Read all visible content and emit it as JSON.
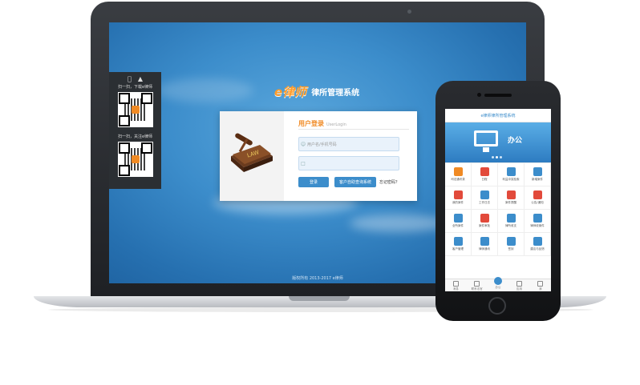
{
  "colors": {
    "accent": "#3c8dcb",
    "orange": "#f08a24",
    "screen_bg": "#3c8dcb"
  },
  "qr_panel": {
    "os_icons": [
      "apple-icon",
      "android-icon"
    ],
    "download_caption": "扫一扫，下载e律师",
    "follow_caption": "扫一扫，关注e律师"
  },
  "brand": {
    "logo": "e律师",
    "title": "律所管理系统"
  },
  "login": {
    "title": "用户登录",
    "subtitle": "UserLogin",
    "username_placeholder": "用户名/手机号码",
    "password_placeholder": "",
    "login_button": "登录",
    "client_button": "客户自助查询系统",
    "forgot_link": "忘记密码？"
  },
  "footer": {
    "copyright": "版权所有 2013-2017 e律师"
  },
  "phone": {
    "header_title": "e律师律所管理系统",
    "banner_text": "办公",
    "grid": [
      {
        "label": "司法通讯录",
        "color": "#f08a24"
      },
      {
        "label": "日程",
        "color": "#e24a3b"
      },
      {
        "label": "利益冲突检索",
        "color": "#3c8dcb"
      },
      {
        "label": "新增案件",
        "color": "#3c8dcb"
      },
      {
        "label": "我的案件",
        "color": "#e24a3b"
      },
      {
        "label": "工作日志",
        "color": "#3c8dcb"
      },
      {
        "label": "案件提醒",
        "color": "#e24a3b"
      },
      {
        "label": "公告/通知",
        "color": "#e24a3b"
      },
      {
        "label": "全所案件",
        "color": "#3c8dcb"
      },
      {
        "label": "案件审批",
        "color": "#e24a3b"
      },
      {
        "label": "律所收支",
        "color": "#3c8dcb"
      },
      {
        "label": "律师收案件",
        "color": "#3c8dcb"
      },
      {
        "label": "客户管理",
        "color": "#3c8dcb"
      },
      {
        "label": "律师通讯",
        "color": "#3c8dcb"
      },
      {
        "label": "签到",
        "color": "#3c8dcb"
      },
      {
        "label": "建议与反馈",
        "color": "#3c8dcb"
      }
    ],
    "tabs": [
      {
        "label": "消息"
      },
      {
        "label": "联系法官"
      },
      {
        "label": "办公"
      },
      {
        "label": "应用"
      },
      {
        "label": "我"
      }
    ]
  }
}
